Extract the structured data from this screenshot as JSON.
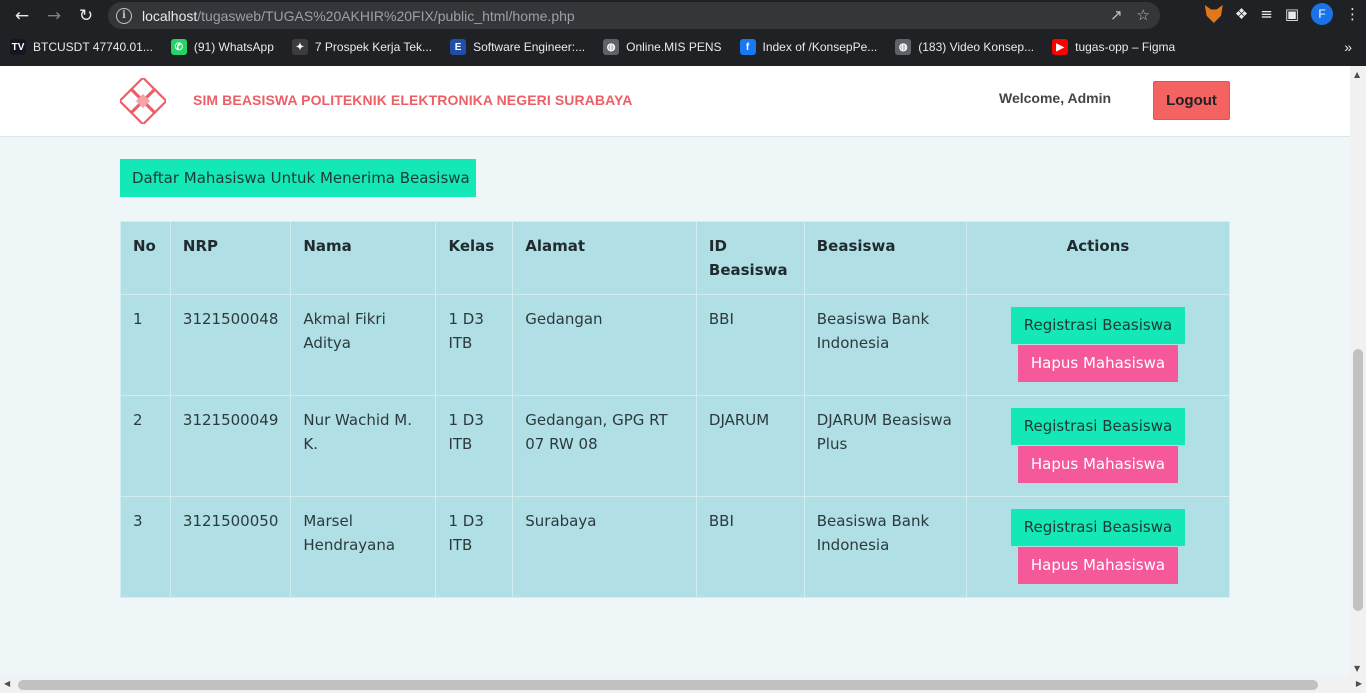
{
  "browser": {
    "url_host": "localhost",
    "url_path": "/tugasweb/TUGAS%20AKHIR%20FIX/public_html/home.php",
    "profile_initial": "F",
    "bookmarks": [
      {
        "label": "BTCUSDT 47740.01...",
        "icon": "tradingview-icon",
        "color": "#131722",
        "glyph": "TV"
      },
      {
        "label": "(91) WhatsApp",
        "icon": "whatsapp-icon",
        "color": "#25d366",
        "glyph": "✆"
      },
      {
        "label": "7 Prospek Kerja Tek...",
        "icon": "prospek-icon",
        "color": "#3c3c3c",
        "glyph": "✦"
      },
      {
        "label": "Software Engineer:...",
        "icon": "e-icon",
        "color": "#1f4fa8",
        "glyph": "E"
      },
      {
        "label": "Online.MIS PENS",
        "icon": "globe-icon",
        "color": "#5f6368",
        "glyph": "◍"
      },
      {
        "label": "Index of /KonsepPe...",
        "icon": "facebook-icon",
        "color": "#1877f2",
        "glyph": "f"
      },
      {
        "label": "(183) Video Konsep...",
        "icon": "globe-icon",
        "color": "#5f6368",
        "glyph": "◍"
      },
      {
        "label": "tugas-opp – Figma",
        "icon": "youtube-icon",
        "color": "#ff0000",
        "glyph": "▶"
      }
    ],
    "bookmarks_more": "»"
  },
  "navbar": {
    "brand": "SIM BEASISWA POLITEKNIK ELEKTRONIKA NEGERI SURABAYA",
    "welcome": "Welcome, Admin",
    "logout": "Logout"
  },
  "page": {
    "title_button": "Daftar Mahasiswa Untuk Menerima Beasiswa"
  },
  "table": {
    "headers": {
      "no": "No",
      "nrp": "NRP",
      "nama": "Nama",
      "kelas": "Kelas",
      "alamat": "Alamat",
      "id_beasiswa": "ID Beasiswa",
      "beasiswa": "Beasiswa",
      "actions": "Actions"
    },
    "rows": [
      {
        "no": "1",
        "nrp": "3121500048",
        "nama": "Akmal Fikri Aditya",
        "kelas": "1 D3 ITB",
        "alamat": "Gedangan",
        "id_beasiswa": "BBI",
        "beasiswa": "Beasiswa Bank Indonesia",
        "register": "Registrasi Beasiswa",
        "delete": "Hapus Mahasiswa"
      },
      {
        "no": "2",
        "nrp": "3121500049",
        "nama": "Nur Wachid M. K.",
        "kelas": "1 D3 ITB",
        "alamat": "Gedangan, GPG RT 07 RW 08",
        "id_beasiswa": "DJARUM",
        "beasiswa": "DJARUM Beasiswa Plus",
        "register": "Registrasi Beasiswa",
        "delete": "Hapus Mahasiswa"
      },
      {
        "no": "3",
        "nrp": "3121500050",
        "nama": "Marsel Hendrayana",
        "kelas": "1 D3 ITB",
        "alamat": "Surabaya",
        "id_beasiswa": "BBI",
        "beasiswa": "Beasiswa Bank Indonesia",
        "register": "Registrasi Beasiswa",
        "delete": "Hapus Mahasiswa"
      }
    ]
  },
  "colors": {
    "brand": "#ec5f67",
    "logout": "#f56262",
    "accent_green": "#14e8b7",
    "delete_pink": "#f5599a",
    "table_bg": "#b0dfe5"
  }
}
